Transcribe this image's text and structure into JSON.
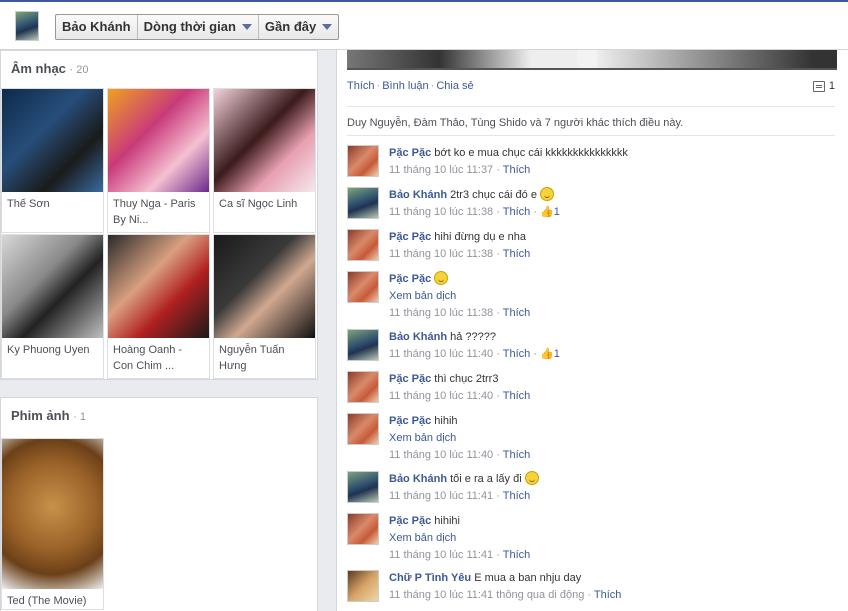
{
  "topbar": {
    "crumbs": [
      "Bảo Khánh",
      "Dòng thời gian",
      "Gần đây"
    ]
  },
  "music": {
    "title": "Âm nhạc",
    "count": "· 20",
    "items": [
      {
        "label": "Thế Sơn"
      },
      {
        "label": "Thuy Nga - Paris By Ni..."
      },
      {
        "label": "Ca sĩ Ngọc Linh"
      },
      {
        "label": "Ky Phuong Uyen"
      },
      {
        "label": "Hoàng Oanh - Con Chim ..."
      },
      {
        "label": "Nguyễn Tuấn Hưng"
      }
    ]
  },
  "movies": {
    "title": "Phim ảnh",
    "count": "· 1",
    "items": [
      {
        "label": "Ted (The Movie)"
      }
    ]
  },
  "post": {
    "actions": {
      "like": "Thích",
      "comment": "Bình luận",
      "share": "Chia sẻ",
      "comment_count": "1"
    },
    "likes_summary": "Duy Nguyễn, Đàm Thảo, Tùng Shido và 7 người khác thích điều này."
  },
  "comments": [
    {
      "name": "Pặc Pặc",
      "text": "bớt ko e mua chục cái kkkkkkkkkkkkkkk",
      "time": "11 tháng 10 lúc 11:37",
      "like": "Thích"
    },
    {
      "name": "Bảo Khánh",
      "text": "2tr3 chục cái đó e",
      "time": "11 tháng 10 lúc 11:38",
      "like": "Thích",
      "likes": "1"
    },
    {
      "name": "Pặc Pặc",
      "text": "hihi đừng dụ e nha",
      "time": "11 tháng 10 lúc 11:38",
      "like": "Thích"
    },
    {
      "name": "Pặc Pặc",
      "text": "",
      "translate": "Xem bản dịch",
      "time": "11 tháng 10 lúc 11:38",
      "like": "Thích"
    },
    {
      "name": "Bảo Khánh",
      "text": "hả ?????",
      "time": "11 tháng 10 lúc 11:40",
      "like": "Thích",
      "likes": "1"
    },
    {
      "name": "Pặc Pặc",
      "text": "thì chục 2trr3",
      "time": "11 tháng 10 lúc 11:40",
      "like": "Thích"
    },
    {
      "name": "Pặc Pặc",
      "text": "hihih",
      "translate": "Xem bản dịch",
      "time": "11 tháng 10 lúc 11:40",
      "like": "Thích"
    },
    {
      "name": "Bảo Khánh",
      "text": "tối e ra a lấy đi",
      "time": "11 tháng 10 lúc 11:41",
      "like": "Thích"
    },
    {
      "name": "Pặc Pặc",
      "text": "hihihi",
      "translate": "Xem bản dịch",
      "time": "11 tháng 10 lúc 11:41",
      "like": "Thích"
    },
    {
      "name": "Chữ P Tình Yêu",
      "text": "E mua a ban nhju day",
      "time": "11 tháng 10 lúc 11:41 thông qua di động",
      "like": "Thích"
    }
  ]
}
